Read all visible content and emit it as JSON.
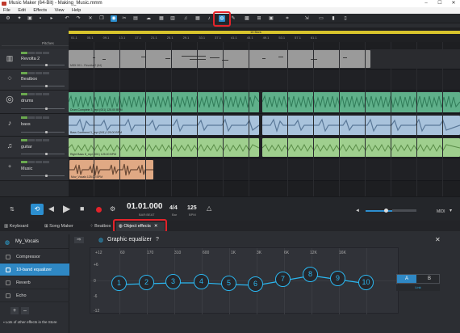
{
  "window": {
    "title": "Music Maker (64-Bit) - Making_Music.mmm",
    "controls": [
      "–",
      "☐",
      "✕"
    ]
  },
  "menu": [
    "File",
    "Edit",
    "Effects",
    "View",
    "Help"
  ],
  "ruler": {
    "range_label": "16 Bars",
    "marks": [
      "01.1",
      "05.1",
      "09.1",
      "13.1",
      "17.1",
      "21.1",
      "25.1",
      "29.1",
      "33.1",
      "37.1",
      "41.1",
      "45.1",
      "49.1",
      "53.1",
      "57.1",
      "61.1",
      "65.1",
      "69.1"
    ]
  },
  "pitches_label": "Pitches",
  "tracks": [
    {
      "name": "Revolta 2",
      "icon": "piano-icon"
    },
    {
      "name": "Beatbox",
      "icon": "drum-pad-icon"
    },
    {
      "name": "drums",
      "icon": "drum-kit-icon"
    },
    {
      "name": "bass",
      "icon": "bass-guitar-icon"
    },
    {
      "name": "guitar",
      "icon": "guitar-icon"
    },
    {
      "name": "Music",
      "icon": "track-icon"
    }
  ],
  "track_buttons": [
    "SOLO",
    "MUTE",
    "REC",
    "FX"
  ],
  "clips": {
    "revolta": "MIDI 001 - Revolta 2 (64)",
    "drums": "Drum Complete 3_repl (001) 125.00 BPM",
    "bass": "Bass Comment 3_repl (001) 125.00 BPM",
    "guitar": "Right Bass 8_repl (001) 125.00 BPM",
    "music": "Muv_Vocals 125.00 BPM"
  },
  "transport": {
    "time": "01.01.000",
    "time_sub": "BAR:BEAT",
    "signature": "4/4",
    "signature_sub": "Bar",
    "bpm": "125",
    "bpm_sub": "BPM",
    "midi": "MIDI"
  },
  "tabs": [
    {
      "label": "Keyboard",
      "icon": "keyboard-icon"
    },
    {
      "label": "Song Maker",
      "icon": "song-maker-icon"
    },
    {
      "label": "Beatbox",
      "icon": "beatbox-icon"
    },
    {
      "label": "Object effects",
      "icon": "object-effects-icon",
      "active": true
    }
  ],
  "effects_panel": {
    "track_name": "My_Vocals",
    "effects": [
      "Compressor",
      "10-band equalizer",
      "Reverb",
      "Echo"
    ],
    "selected": "10-band equalizer",
    "add": "+",
    "remove": "–",
    "store_text": "Lots of other effects in the Store"
  },
  "equalizer": {
    "title": "Graphic equalizer",
    "help": "?",
    "close": "✕",
    "freq_labels": [
      "60",
      "170",
      "310",
      "600",
      "1K",
      "3K",
      "6K",
      "12K",
      "16K"
    ],
    "db_labels": [
      "+12",
      "+6",
      "0",
      "-6",
      "-12"
    ],
    "bands": [
      "1",
      "2",
      "3",
      "4",
      "5",
      "6",
      "7",
      "8",
      "9",
      "10"
    ],
    "ab": {
      "a": "A",
      "b": "B",
      "link": "Link"
    }
  }
}
